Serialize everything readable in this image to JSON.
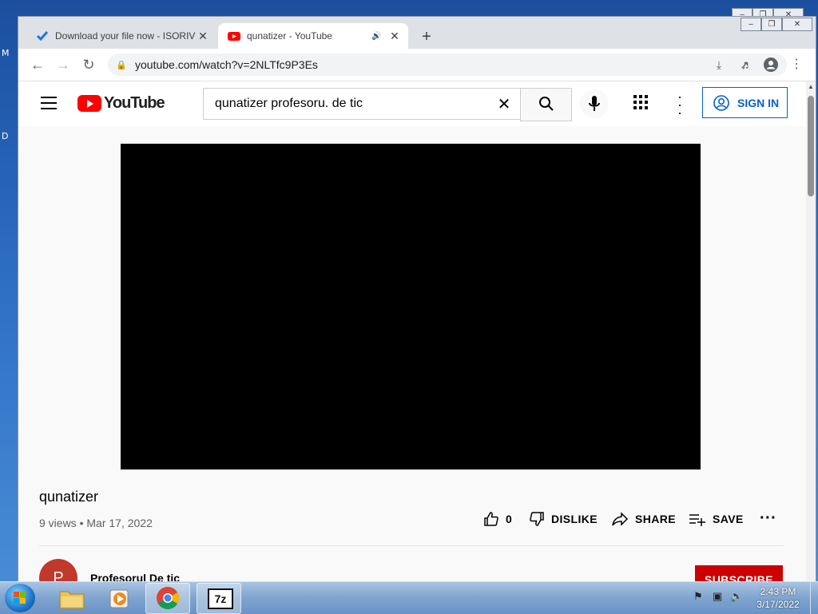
{
  "desktop": {
    "letters": [
      "M",
      "D"
    ]
  },
  "browser": {
    "tabs": [
      {
        "title": "Download your file now - ISORIV",
        "active": false
      },
      {
        "title": "qunatizer - YouTube",
        "active": true
      }
    ],
    "url": "youtube.com/watch?v=2NLTfc9P3Es"
  },
  "youtube": {
    "logo_text": "YouTube",
    "search_value": "qunatizer profesoru. de tic",
    "sign_in_label": "SIGN IN",
    "video": {
      "title": "qunatizer",
      "views": "9 views",
      "date": "Mar 17, 2022",
      "likes": "0",
      "dislike_label": "DISLIKE",
      "share_label": "SHARE",
      "save_label": "SAVE"
    },
    "channel": {
      "initial": "P",
      "name": "Profesorul De tic"
    },
    "subscribe_label": "SUBSCRIBE"
  },
  "taskbar": {
    "time": "2:43 PM",
    "date": "3/17/2022"
  },
  "colors": {
    "youtube_red": "#ff0000",
    "link_blue": "#065fd4",
    "subscribe_red": "#cc0000"
  }
}
